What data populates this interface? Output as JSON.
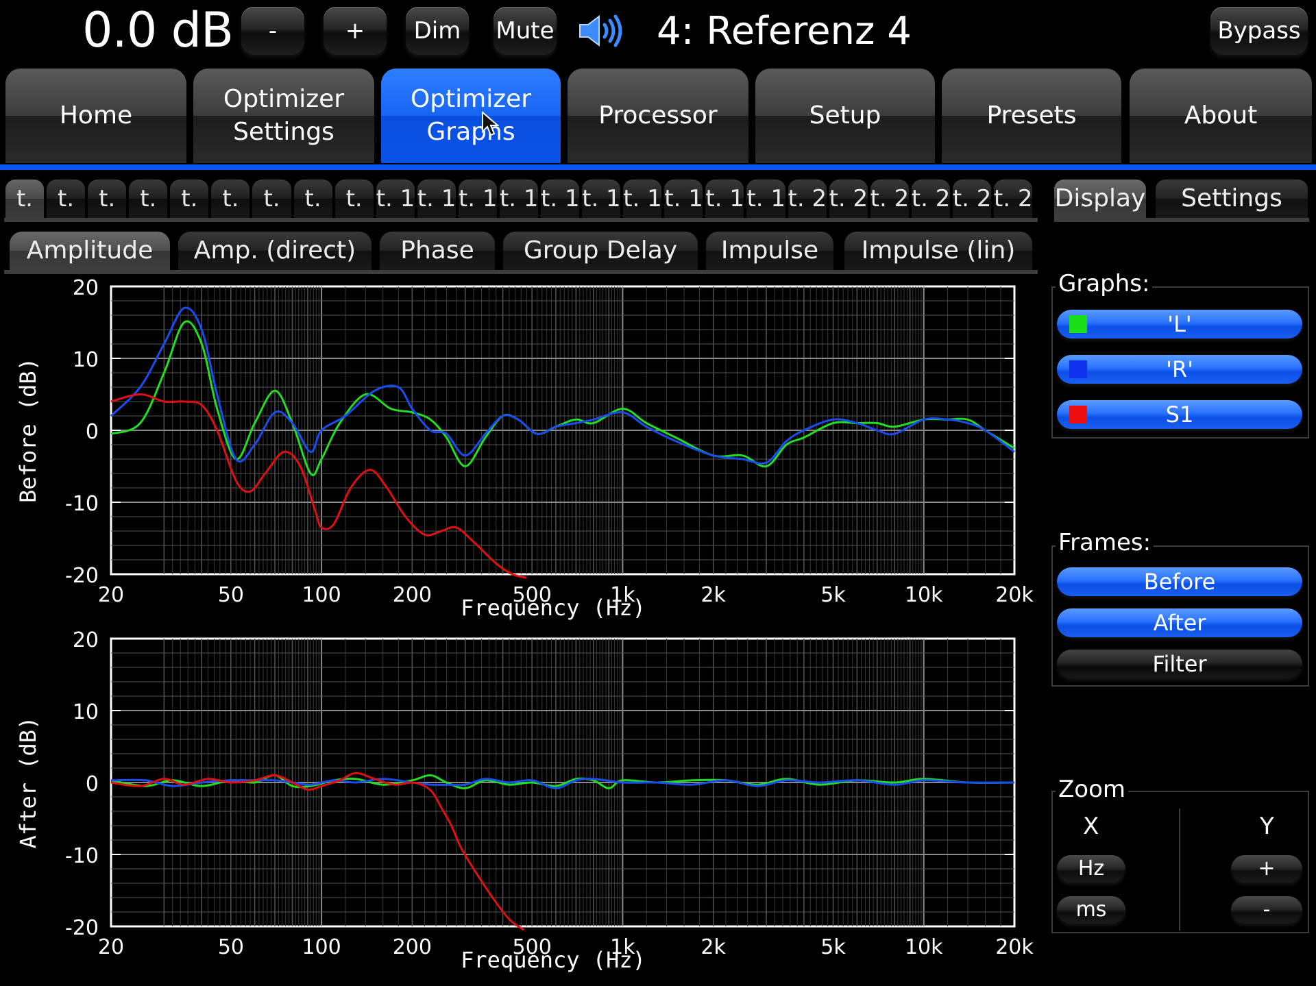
{
  "topbar": {
    "volume": "0.0 dB",
    "buttons": {
      "minus": "-",
      "plus": "+",
      "dim": "Dim",
      "mute": "Mute",
      "bypass": "Bypass"
    },
    "speaker_icon": "speaker-volume-icon",
    "preset": "4: Referenz 4"
  },
  "main_tabs": [
    {
      "label_line1": "Home",
      "label_line2": ""
    },
    {
      "label_line1": "Optimizer",
      "label_line2": "Settings"
    },
    {
      "label_line1": "Optimizer",
      "label_line2": "Graphs"
    },
    {
      "label_line1": "Processor",
      "label_line2": ""
    },
    {
      "label_line1": "Setup",
      "label_line2": ""
    },
    {
      "label_line1": "Presets",
      "label_line2": ""
    },
    {
      "label_line1": "About",
      "label_line2": ""
    }
  ],
  "measurement_tabs": [
    "t.",
    "t.",
    "t.",
    "t.",
    "t.",
    "t.",
    "t.",
    "t.",
    "t.",
    "t. 1",
    "t. 1",
    "t. 1",
    "t. 1",
    "t. 1",
    "t. 1",
    "t. 1",
    "t. 1",
    "t. 1",
    "t. 1",
    "t. 2",
    "t. 2",
    "t. 2",
    "t. 2",
    "t. 2",
    "t. 2"
  ],
  "graph_tabs": [
    "Amplitude",
    "Amp. (direct)",
    "Phase",
    "Group Delay",
    "Impulse",
    "Impulse (lin)"
  ],
  "side_panel": {
    "tabs": [
      "Display",
      "Settings"
    ],
    "graphs_title": "Graphs:",
    "graphs": [
      {
        "label": "'L'",
        "color": "#19e019"
      },
      {
        "label": "'R'",
        "color": "#1030f0"
      },
      {
        "label": "S1",
        "color": "#ee1010"
      }
    ],
    "frames_title": "Frames:",
    "frames": [
      {
        "label": "Before",
        "active": true
      },
      {
        "label": "After",
        "active": true
      },
      {
        "label": "Filter",
        "active": false
      }
    ],
    "zoom_title": "Zoom",
    "zoom_x": "X",
    "zoom_y": "Y",
    "zoom_x_buttons": [
      "Hz",
      "ms"
    ],
    "zoom_y_buttons": [
      "+",
      "-"
    ]
  },
  "chart_data": [
    {
      "type": "line",
      "ylabel": "Before (dB)",
      "xlabel": "Frequency (Hz)",
      "x_scale": "log",
      "xlim": [
        20,
        20000
      ],
      "ylim": [
        -20,
        20
      ],
      "x_ticks": [
        "20",
        "50",
        "100",
        "200",
        "500",
        "1k",
        "2k",
        "5k",
        "10k",
        "20k"
      ],
      "y_ticks": [
        "20",
        "10",
        "0",
        "-10",
        "-20"
      ],
      "grid": true,
      "series": [
        {
          "color": "#22dd22",
          "points": [
            [
              20,
              -0.5
            ],
            [
              25,
              1
            ],
            [
              30,
              8
            ],
            [
              35,
              15
            ],
            [
              40,
              12
            ],
            [
              45,
              3
            ],
            [
              52,
              -4
            ],
            [
              60,
              1
            ],
            [
              70,
              5.5
            ],
            [
              80,
              1
            ],
            [
              92,
              -6
            ],
            [
              100,
              -4
            ],
            [
              115,
              1
            ],
            [
              140,
              5
            ],
            [
              170,
              3
            ],
            [
              200,
              2.5
            ],
            [
              230,
              1.5
            ],
            [
              260,
              -1
            ],
            [
              300,
              -5
            ],
            [
              350,
              -1
            ],
            [
              400,
              2
            ],
            [
              450,
              1.5
            ],
            [
              520,
              -0.5
            ],
            [
              600,
              0.5
            ],
            [
              700,
              1.5
            ],
            [
              800,
              1
            ],
            [
              1000,
              3
            ],
            [
              1200,
              1
            ],
            [
              1500,
              -1
            ],
            [
              2000,
              -3.5
            ],
            [
              2500,
              -3.5
            ],
            [
              3000,
              -5
            ],
            [
              3500,
              -2
            ],
            [
              4000,
              -1
            ],
            [
              5000,
              1
            ],
            [
              6000,
              1
            ],
            [
              7000,
              1
            ],
            [
              8000,
              0.5
            ],
            [
              10000,
              1.5
            ],
            [
              12000,
              1.5
            ],
            [
              14000,
              1.5
            ],
            [
              16000,
              0
            ],
            [
              20000,
              -2.5
            ]
          ]
        },
        {
          "color": "#1a4cf0",
          "points": [
            [
              20,
              2
            ],
            [
              25,
              6
            ],
            [
              30,
              12
            ],
            [
              35,
              17
            ],
            [
              40,
              14
            ],
            [
              45,
              5
            ],
            [
              52,
              -4
            ],
            [
              60,
              -2
            ],
            [
              70,
              2.5
            ],
            [
              80,
              1
            ],
            [
              92,
              -3
            ],
            [
              100,
              0
            ],
            [
              120,
              2
            ],
            [
              150,
              5.5
            ],
            [
              180,
              6
            ],
            [
              200,
              3
            ],
            [
              230,
              0
            ],
            [
              260,
              -0.5
            ],
            [
              300,
              -3.5
            ],
            [
              350,
              -0.5
            ],
            [
              400,
              2
            ],
            [
              450,
              1.5
            ],
            [
              520,
              -0.5
            ],
            [
              600,
              0.5
            ],
            [
              700,
              1
            ],
            [
              800,
              1.5
            ],
            [
              1000,
              2.5
            ],
            [
              1200,
              0.5
            ],
            [
              1500,
              -1.5
            ],
            [
              2000,
              -3.5
            ],
            [
              2500,
              -4
            ],
            [
              3000,
              -4.5
            ],
            [
              3500,
              -1.5
            ],
            [
              4000,
              0
            ],
            [
              5000,
              1.5
            ],
            [
              6000,
              1
            ],
            [
              7000,
              0
            ],
            [
              8000,
              -0.5
            ],
            [
              10000,
              1.5
            ],
            [
              12000,
              1.5
            ],
            [
              14000,
              1
            ],
            [
              16000,
              0
            ],
            [
              20000,
              -3
            ]
          ]
        },
        {
          "color": "#e01010",
          "points": [
            [
              20,
              4
            ],
            [
              25,
              5
            ],
            [
              30,
              4
            ],
            [
              35,
              4
            ],
            [
              40,
              3.5
            ],
            [
              45,
              0
            ],
            [
              52,
              -7
            ],
            [
              58,
              -8.5
            ],
            [
              65,
              -6
            ],
            [
              75,
              -3
            ],
            [
              85,
              -5
            ],
            [
              95,
              -11
            ],
            [
              100,
              -13.5
            ],
            [
              110,
              -13
            ],
            [
              125,
              -8
            ],
            [
              145,
              -5.5
            ],
            [
              165,
              -8
            ],
            [
              190,
              -12
            ],
            [
              220,
              -14.5
            ],
            [
              250,
              -14
            ],
            [
              280,
              -13.5
            ],
            [
              320,
              -15.5
            ],
            [
              380,
              -18.5
            ],
            [
              430,
              -20
            ],
            [
              480,
              -20.5
            ]
          ]
        }
      ]
    },
    {
      "type": "line",
      "ylabel": "After (dB)",
      "xlabel": "Frequency (Hz)",
      "x_scale": "log",
      "xlim": [
        20,
        20000
      ],
      "ylim": [
        -20,
        20
      ],
      "x_ticks": [
        "20",
        "50",
        "100",
        "200",
        "500",
        "1k",
        "2k",
        "5k",
        "10k",
        "20k"
      ],
      "y_ticks": [
        "20",
        "10",
        "0",
        "-10",
        "-20"
      ],
      "grid": true,
      "series": [
        {
          "color": "#22dd22",
          "points": [
            [
              20,
              0.3
            ],
            [
              26,
              -0.5
            ],
            [
              32,
              0.3
            ],
            [
              40,
              -0.5
            ],
            [
              50,
              0.3
            ],
            [
              60,
              0
            ],
            [
              70,
              1
            ],
            [
              80,
              -0.5
            ],
            [
              92,
              -0.5
            ],
            [
              110,
              0.3
            ],
            [
              130,
              0.5
            ],
            [
              160,
              -0.3
            ],
            [
              200,
              0.3
            ],
            [
              230,
              1
            ],
            [
              260,
              0
            ],
            [
              300,
              -0.8
            ],
            [
              350,
              0.3
            ],
            [
              420,
              -0.3
            ],
            [
              500,
              0
            ],
            [
              600,
              -0.5
            ],
            [
              700,
              0.5
            ],
            [
              800,
              0.3
            ],
            [
              900,
              -0.8
            ],
            [
              1000,
              0.3
            ],
            [
              1300,
              0
            ],
            [
              1700,
              0.3
            ],
            [
              2200,
              0.3
            ],
            [
              2800,
              -0.3
            ],
            [
              3500,
              0.5
            ],
            [
              4500,
              -0.3
            ],
            [
              6000,
              0.3
            ],
            [
              8000,
              0
            ],
            [
              10000,
              0.5
            ],
            [
              14000,
              0
            ],
            [
              20000,
              0
            ]
          ]
        },
        {
          "color": "#1a4cf0",
          "points": [
            [
              20,
              0.3
            ],
            [
              26,
              0.3
            ],
            [
              32,
              -0.5
            ],
            [
              40,
              0
            ],
            [
              50,
              0.3
            ],
            [
              60,
              0.3
            ],
            [
              70,
              0.3
            ],
            [
              80,
              0
            ],
            [
              92,
              -0.3
            ],
            [
              110,
              0.3
            ],
            [
              130,
              0
            ],
            [
              160,
              0.5
            ],
            [
              200,
              0
            ],
            [
              230,
              -0.3
            ],
            [
              260,
              -0.3
            ],
            [
              300,
              -0.3
            ],
            [
              350,
              0.5
            ],
            [
              420,
              0
            ],
            [
              500,
              0.3
            ],
            [
              600,
              -0.8
            ],
            [
              700,
              0.3
            ],
            [
              800,
              0.5
            ],
            [
              1000,
              0
            ],
            [
              1300,
              0
            ],
            [
              1700,
              -0.3
            ],
            [
              2200,
              0.3
            ],
            [
              2800,
              -0.5
            ],
            [
              3500,
              0.3
            ],
            [
              4500,
              0
            ],
            [
              6000,
              0.3
            ],
            [
              8000,
              -0.3
            ],
            [
              10000,
              0.3
            ],
            [
              14000,
              0
            ],
            [
              20000,
              0
            ]
          ]
        },
        {
          "color": "#e01010",
          "points": [
            [
              20,
              0
            ],
            [
              25,
              -0.5
            ],
            [
              30,
              0.5
            ],
            [
              35,
              -0.3
            ],
            [
              42,
              0.5
            ],
            [
              50,
              0
            ],
            [
              60,
              0.3
            ],
            [
              70,
              1
            ],
            [
              80,
              0
            ],
            [
              90,
              -1
            ],
            [
              100,
              -0.5
            ],
            [
              115,
              0.3
            ],
            [
              130,
              1.3
            ],
            [
              150,
              0.5
            ],
            [
              175,
              -0.3
            ],
            [
              200,
              0
            ],
            [
              220,
              -0.5
            ],
            [
              235,
              -1.5
            ],
            [
              250,
              -3.5
            ],
            [
              270,
              -6
            ],
            [
              290,
              -9
            ],
            [
              320,
              -12
            ],
            [
              370,
              -16
            ],
            [
              420,
              -19
            ],
            [
              470,
              -20.5
            ]
          ]
        }
      ]
    }
  ]
}
